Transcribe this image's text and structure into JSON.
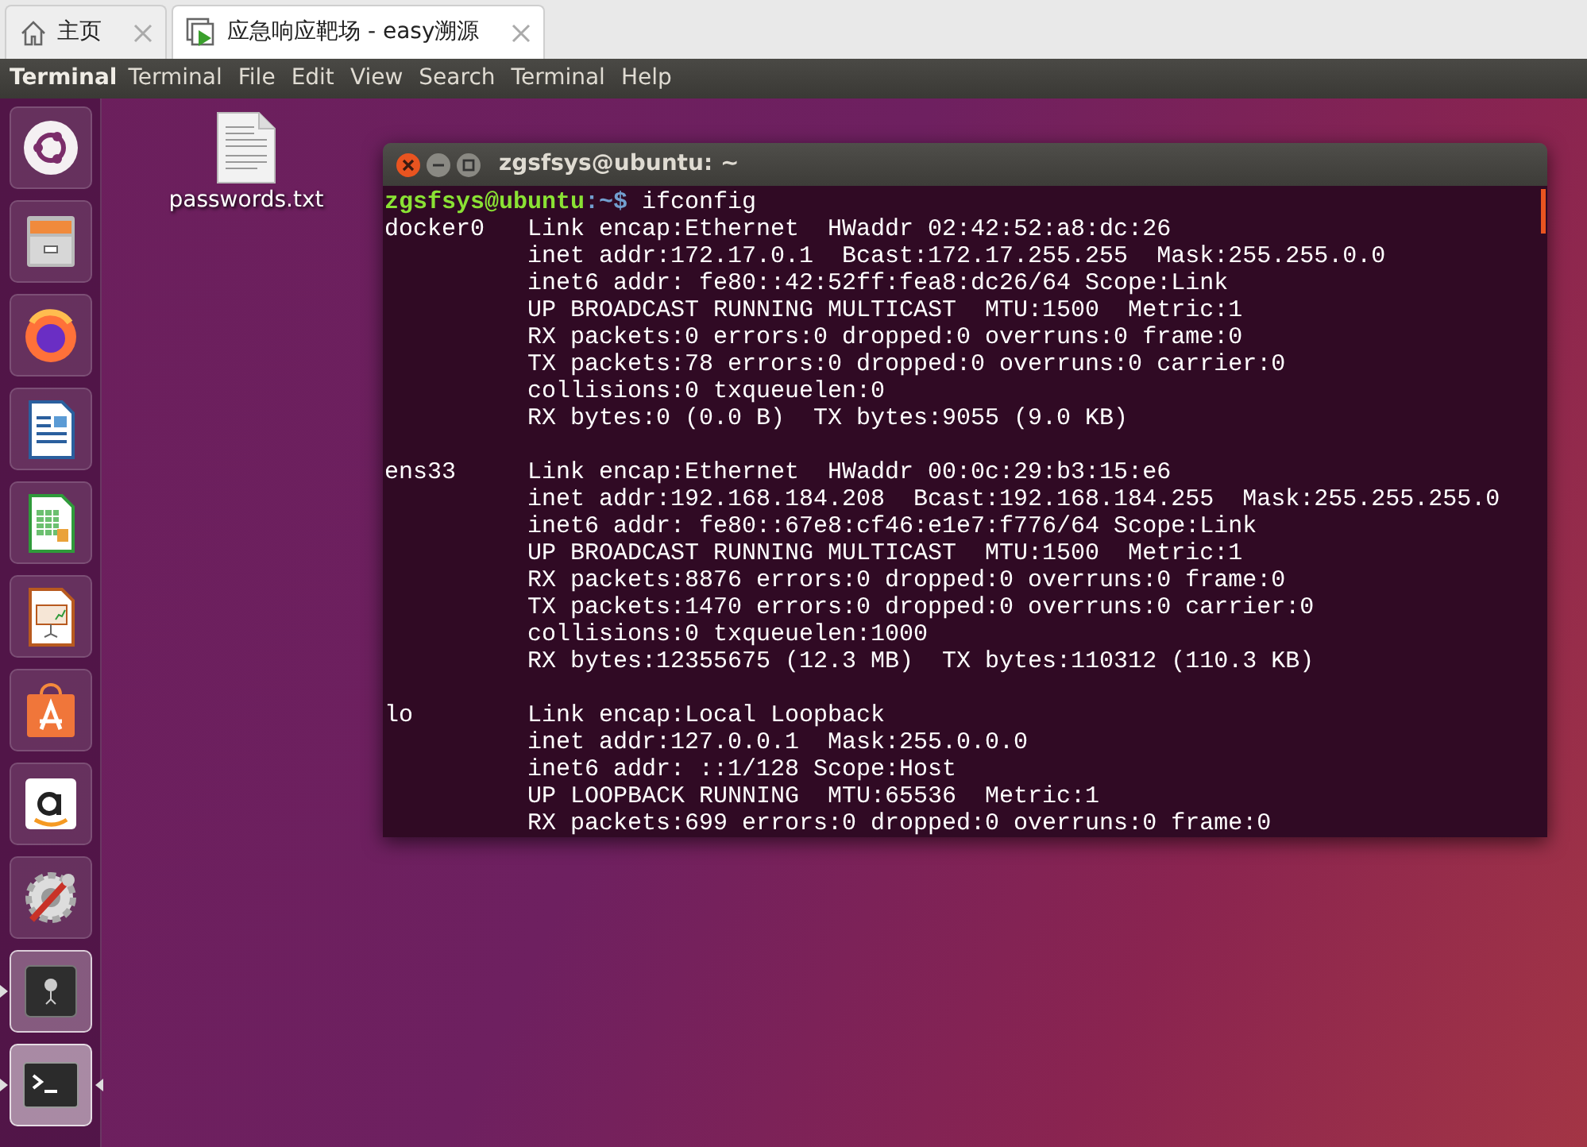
{
  "browser_tabs": [
    {
      "label": "主页",
      "selected": false
    },
    {
      "label": "应急响应靶场 - easy溯源",
      "selected": true
    }
  ],
  "menu_bar": {
    "app_name": "Terminal",
    "items": [
      "Terminal",
      "File",
      "Edit",
      "View",
      "Search",
      "Terminal",
      "Help"
    ]
  },
  "launcher": [
    {
      "kind": "ubuntu",
      "running": false,
      "focused": false
    },
    {
      "kind": "files",
      "running": false,
      "focused": false
    },
    {
      "kind": "firefox",
      "running": false,
      "focused": false
    },
    {
      "kind": "writer",
      "running": false,
      "focused": false
    },
    {
      "kind": "calc",
      "running": false,
      "focused": false
    },
    {
      "kind": "impress",
      "running": false,
      "focused": false
    },
    {
      "kind": "store",
      "running": false,
      "focused": false
    },
    {
      "kind": "amazon",
      "running": false,
      "focused": false
    },
    {
      "kind": "settings",
      "running": false,
      "focused": false
    },
    {
      "kind": "safe",
      "running": true,
      "focused": false
    },
    {
      "kind": "terminal",
      "running": true,
      "focused": true
    }
  ],
  "desktop_file": {
    "label": "passwords.txt"
  },
  "terminal": {
    "title": "zgsfsys@ubuntu: ~",
    "prompt": {
      "user_host": "zgsfsys@ubuntu",
      "path": ":~$",
      "command": " ifconfig"
    },
    "interfaces": [
      {
        "name": "docker0",
        "lines": [
          "Link encap:Ethernet  HWaddr 02:42:52:a8:dc:26",
          "inet addr:172.17.0.1  Bcast:172.17.255.255  Mask:255.255.0.0",
          "inet6 addr: fe80::42:52ff:fea8:dc26/64 Scope:Link",
          "UP BROADCAST RUNNING MULTICAST  MTU:1500  Metric:1",
          "RX packets:0 errors:0 dropped:0 overruns:0 frame:0",
          "TX packets:78 errors:0 dropped:0 overruns:0 carrier:0",
          "collisions:0 txqueuelen:0",
          "RX bytes:0 (0.0 B)  TX bytes:9055 (9.0 KB)"
        ]
      },
      {
        "name": "ens33",
        "lines": [
          "Link encap:Ethernet  HWaddr 00:0c:29:b3:15:e6",
          "inet addr:192.168.184.208  Bcast:192.168.184.255  Mask:255.255.255.0",
          "inet6 addr: fe80::67e8:cf46:e1e7:f776/64 Scope:Link",
          "UP BROADCAST RUNNING MULTICAST  MTU:1500  Metric:1",
          "RX packets:8876 errors:0 dropped:0 overruns:0 frame:0",
          "TX packets:1470 errors:0 dropped:0 overruns:0 carrier:0",
          "collisions:0 txqueuelen:1000",
          "RX bytes:12355675 (12.3 MB)  TX bytes:110312 (110.3 KB)"
        ]
      },
      {
        "name": "lo",
        "lines": [
          "Link encap:Local Loopback",
          "inet addr:127.0.0.1  Mask:255.0.0.0",
          "inet6 addr: ::1/128 Scope:Host",
          "UP LOOPBACK RUNNING  MTU:65536  Metric:1",
          "RX packets:699 errors:0 dropped:0 overruns:0 frame:0"
        ]
      }
    ]
  }
}
